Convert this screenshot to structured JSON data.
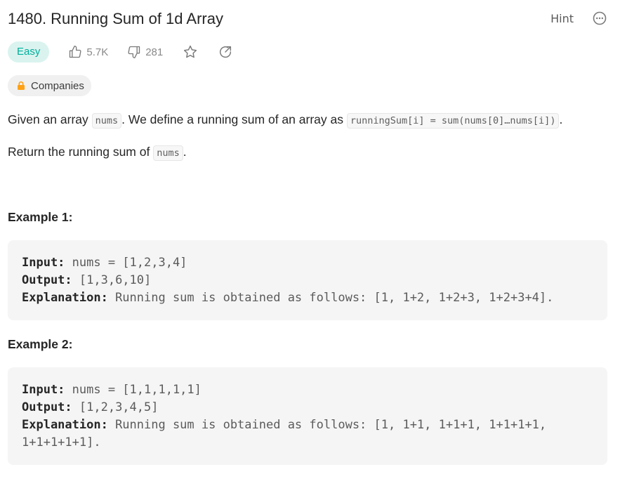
{
  "problem": {
    "title": "1480. Running Sum of 1d Array",
    "hint_label": "Hint",
    "difficulty": "Easy",
    "likes": "5.7K",
    "dislikes": "281",
    "companies_label": "Companies"
  },
  "description": {
    "p1_a": "Given an array ",
    "p1_code1": "nums",
    "p1_b": ". We define a running sum of an array as ",
    "p1_code2": "runningSum[i] = sum(nums[0]…nums[i])",
    "p1_c": ".",
    "p2_a": "Return the running sum of ",
    "p2_code": "nums",
    "p2_b": "."
  },
  "examples": [
    {
      "title": "Example 1:",
      "input_label": "Input:",
      "input": " nums = [1,2,3,4]",
      "output_label": "Output:",
      "output": " [1,3,6,10]",
      "explanation_label": "Explanation:",
      "explanation": " Running sum is obtained as follows: [1, 1+2, 1+2+3, 1+2+3+4].",
      "explanation_cont": ""
    },
    {
      "title": "Example 2:",
      "input_label": "Input:",
      "input": " nums = [1,1,1,1,1]",
      "output_label": "Output:",
      "output": " [1,2,3,4,5]",
      "explanation_label": "Explanation:",
      "explanation": " Running sum is obtained as follows: [1, 1+1, 1+1+1, 1+1+1+1,",
      "explanation_cont": "1+1+1+1+1]."
    }
  ],
  "colors": {
    "easy_bg": "#daf3ef",
    "easy_text": "#00af9b",
    "code_bg": "#f5f5f5"
  }
}
